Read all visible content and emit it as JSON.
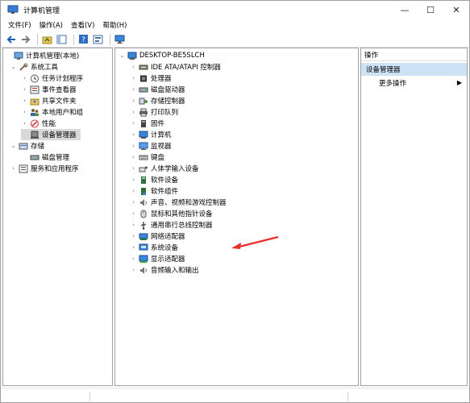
{
  "window": {
    "title": "计算机管理",
    "controls": {
      "minimize": "—",
      "maximize": "☐",
      "close": "✕"
    }
  },
  "menu": [
    "文件(F)",
    "操作(A)",
    "查看(V)",
    "帮助(H)"
  ],
  "left_tree": [
    {
      "label": "计算机管理(本地)",
      "icon": "computer-management-icon"
    },
    {
      "label": "系统工具",
      "icon": "tools-icon"
    },
    {
      "label": "任务计划程序",
      "icon": "clock-icon"
    },
    {
      "label": "事件查看器",
      "icon": "event-viewer-icon"
    },
    {
      "label": "共享文件夹",
      "icon": "shared-folder-icon"
    },
    {
      "label": "本地用户和组",
      "icon": "users-icon"
    },
    {
      "label": "性能",
      "icon": "performance-icon"
    },
    {
      "label": "设备管理器",
      "icon": "device-manager-icon"
    },
    {
      "label": "存储",
      "icon": "storage-icon"
    },
    {
      "label": "磁盘管理",
      "icon": "disk-management-icon"
    },
    {
      "label": "服务和应用程序",
      "icon": "services-icon"
    }
  ],
  "device_tree": {
    "root": "DESKTOP-BE5SLCH",
    "categories": [
      {
        "label": "IDE ATA/ATAPI 控制器",
        "icon": "ide-controller-icon"
      },
      {
        "label": "处理器",
        "icon": "processor-icon"
      },
      {
        "label": "磁盘驱动器",
        "icon": "disk-drive-icon"
      },
      {
        "label": "存储控制器",
        "icon": "storage-controller-icon"
      },
      {
        "label": "打印队列",
        "icon": "printer-icon"
      },
      {
        "label": "固件",
        "icon": "firmware-icon"
      },
      {
        "label": "计算机",
        "icon": "computer-icon"
      },
      {
        "label": "监视器",
        "icon": "monitor-icon"
      },
      {
        "label": "键盘",
        "icon": "keyboard-icon"
      },
      {
        "label": "人体学输入设备",
        "icon": "hid-icon"
      },
      {
        "label": "软件设备",
        "icon": "software-device-icon"
      },
      {
        "label": "软件组件",
        "icon": "software-component-icon"
      },
      {
        "label": "声音、视频和游戏控制器",
        "icon": "sound-icon"
      },
      {
        "label": "鼠标和其他指针设备",
        "icon": "mouse-icon"
      },
      {
        "label": "通用串行总线控制器",
        "icon": "usb-icon"
      },
      {
        "label": "网络适配器",
        "icon": "network-adapter-icon"
      },
      {
        "label": "系统设备",
        "icon": "system-device-icon"
      },
      {
        "label": "显示适配器",
        "icon": "display-adapter-icon"
      },
      {
        "label": "音频输入和输出",
        "icon": "audio-io-icon"
      }
    ]
  },
  "actions": {
    "header": "操作",
    "selected": "设备管理器",
    "more": "更多操作"
  },
  "colors": {
    "selected_action_bg": "#cde3f5",
    "annotation_arrow": "#e8302a",
    "selected_tree_bg": "#d9d9d9"
  }
}
